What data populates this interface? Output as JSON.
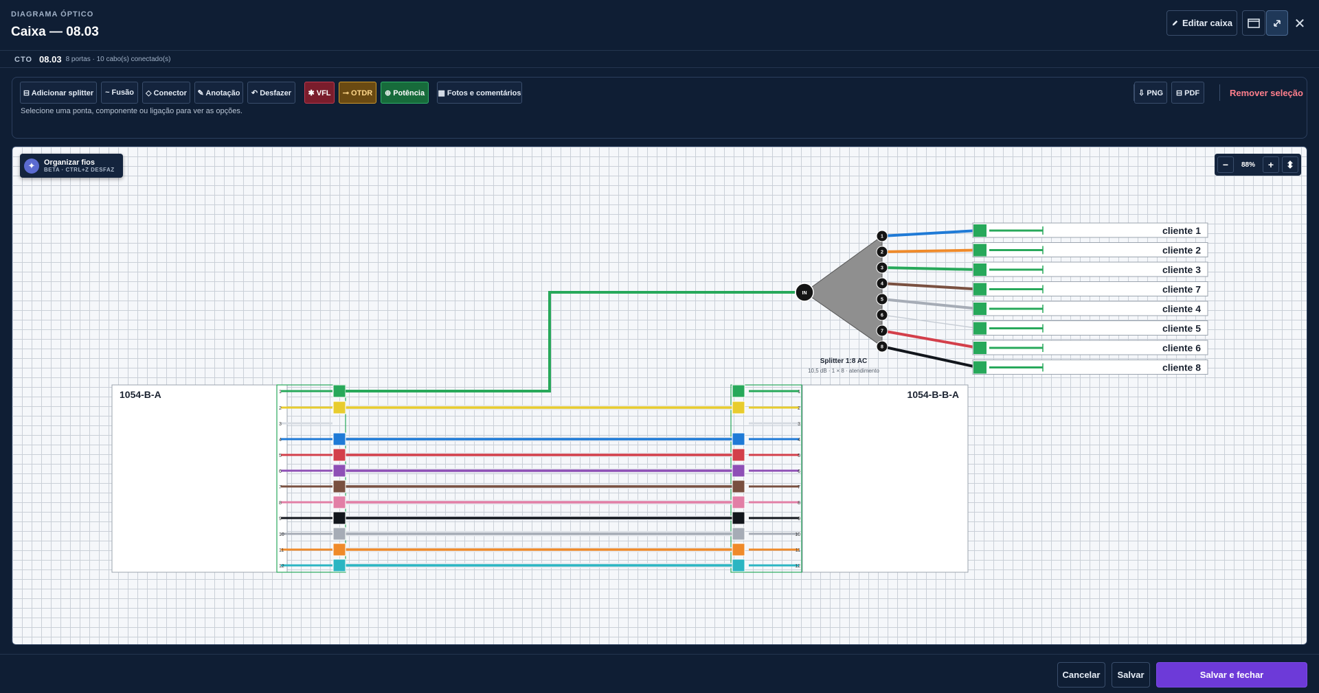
{
  "header": {
    "kicker": "DIAGRAMA ÓPTICO",
    "title": "Caixa — 08.03",
    "edit_label": "Editar caixa",
    "edit_icon": "pencil-icon",
    "window_icon": "window-icon",
    "expand_icon": "expand-icon",
    "close_icon": "close-icon",
    "close_glyph": "✕"
  },
  "info": {
    "tag": "CTO",
    "value": "08.03",
    "meta": "8 portas · 10 cabo(s) conectado(s)"
  },
  "toolbar": {
    "buttons": [
      {
        "label": "⊟ Adicionar splitter",
        "bg": "#14243d",
        "border": "#3a4e6c",
        "color": "#e6edf6"
      },
      {
        "label": "~ Fusão",
        "bg": "#14243d",
        "border": "#3a4e6c",
        "color": "#e6edf6"
      },
      {
        "label": "◇ Conector",
        "bg": "#14243d",
        "border": "#3a4e6c",
        "color": "#e6edf6"
      },
      {
        "label": "✎ Anotação",
        "bg": "#14243d",
        "border": "#3a4e6c",
        "color": "#e6edf6"
      },
      {
        "label": "↶ Desfazer",
        "bg": "#14243d",
        "border": "#3a4e6c",
        "color": "#e6edf6"
      },
      {
        "label": "✱ VFL",
        "bg": "#7a1d2c",
        "border": "#c0394f",
        "color": "#ffffff"
      },
      {
        "label": "⊸ OTDR",
        "bg": "#6a4a12",
        "border": "#d09a2c",
        "color": "#ffd78a"
      },
      {
        "label": "⊕ Potência",
        "bg": "#176b3b",
        "border": "#2fb36a",
        "color": "#ffffff"
      },
      {
        "label": "▦ Fotos e comentários",
        "bg": "#14243d",
        "border": "#3a4e6c",
        "color": "#e6edf6"
      }
    ],
    "export_buttons": [
      {
        "label": "⇩ PNG"
      },
      {
        "label": "⊟ PDF"
      }
    ],
    "remove_selection": "Remover seleção",
    "hint": "Selecione uma ponta, componente ou ligação para ver as opções."
  },
  "canvas": {
    "organizer": {
      "title": "Organizar fios",
      "subtitle": "BETA · CTRL+Z DESFAZ",
      "icon": "sparkle-icon",
      "glyph": "✦"
    },
    "zoom": {
      "minus": "−",
      "value": "88%",
      "plus": "+",
      "fit": "⬍"
    }
  },
  "diagram": {
    "cable_left": {
      "name": "1054-B-A"
    },
    "cable_right": {
      "name": "1054-B-B-A"
    },
    "fibers": [
      {
        "num": "1",
        "color": "#27a85a"
      },
      {
        "num": "2",
        "color": "#e8cc2e"
      },
      {
        "num": "3",
        "color": "#ffffff"
      },
      {
        "num": "4",
        "color": "#1f7ad6"
      },
      {
        "num": "5",
        "color": "#d33f4a"
      },
      {
        "num": "6",
        "color": "#8e50b6"
      },
      {
        "num": "7",
        "color": "#795040"
      },
      {
        "num": "8",
        "color": "#e27fa6"
      },
      {
        "num": "9",
        "color": "#12161c"
      },
      {
        "num": "10",
        "color": "#a6acb6"
      },
      {
        "num": "11",
        "color": "#ef8a2a"
      },
      {
        "num": "12",
        "color": "#2bb5c2"
      }
    ],
    "splitter": {
      "input_label": "IN",
      "name": "Splitter 1:8 AC",
      "detail": "10,5 dB · 1 × 8 · atendimento",
      "body_color": "#8f8f8f",
      "outputs": [
        {
          "num": "1",
          "color": "#1f7ad6",
          "client": "cliente 1"
        },
        {
          "num": "2",
          "color": "#ef8a2a",
          "client": "cliente 2"
        },
        {
          "num": "3",
          "color": "#27a85a",
          "client": "cliente 3"
        },
        {
          "num": "4",
          "color": "#795040",
          "client": "cliente 7"
        },
        {
          "num": "5",
          "color": "#a6acb6",
          "client": "cliente 4"
        },
        {
          "num": "6",
          "color": "#ffffff",
          "client": "cliente 5"
        },
        {
          "num": "7",
          "color": "#d33f4a",
          "client": "cliente 6"
        },
        {
          "num": "8",
          "color": "#12161c",
          "client": "cliente 8"
        }
      ]
    }
  },
  "footer": {
    "cancel": "Cancelar",
    "save": "Salvar",
    "save_close": "Salvar e fechar"
  }
}
